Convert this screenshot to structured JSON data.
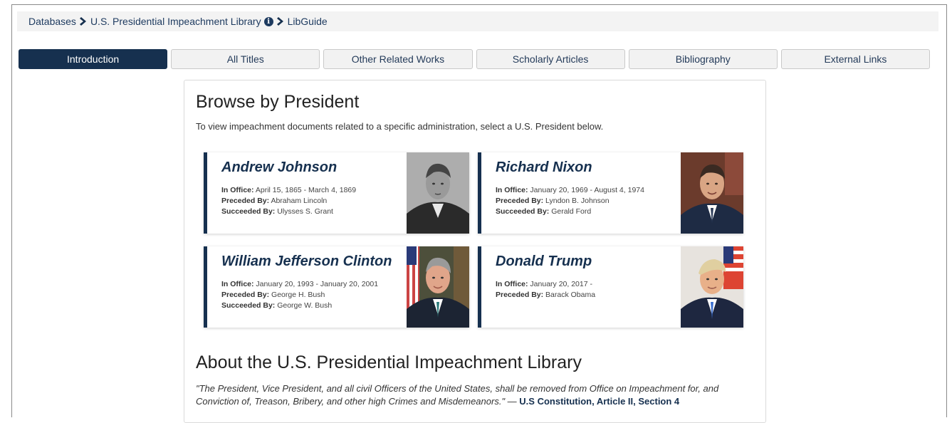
{
  "breadcrumb": {
    "items": [
      "Databases",
      "U.S. Presidential Impeachment Library",
      "LibGuide"
    ]
  },
  "tabs": [
    {
      "label": "Introduction",
      "active": true
    },
    {
      "label": "All Titles",
      "active": false
    },
    {
      "label": "Other Related Works",
      "active": false
    },
    {
      "label": "Scholarly Articles",
      "active": false
    },
    {
      "label": "Bibliography",
      "active": false
    },
    {
      "label": "External Links",
      "active": false
    }
  ],
  "browse": {
    "title": "Browse by President",
    "subtitle": "To view impeachment documents related to a specific administration, select a U.S. President below."
  },
  "presidents": [
    {
      "name": "Andrew Johnson",
      "in_office_label": "In Office:",
      "in_office": " April 15, 1865 - March 4, 1869",
      "preceded_label": "Preceded By:",
      "preceded": " Abraham Lincoln",
      "succeeded_label": "Succeeded By:",
      "succeeded": " Ulysses S. Grant"
    },
    {
      "name": "Richard Nixon",
      "in_office_label": "In Office:",
      "in_office": " January 20, 1969 - August 4, 1974",
      "preceded_label": "Preceded By:",
      "preceded": " Lyndon B. Johnson",
      "succeeded_label": "Succeeded By:",
      "succeeded": " Gerald Ford"
    },
    {
      "name": "William Jefferson Clinton",
      "in_office_label": "In Office:",
      "in_office": " January 20, 1993 - January 20, 2001",
      "preceded_label": "Preceded By:",
      "preceded": " George H. Bush",
      "succeeded_label": "Succeeded By:",
      "succeeded": " George W. Bush"
    },
    {
      "name": "Donald Trump",
      "in_office_label": "In Office:",
      "in_office": " January 20, 2017 -",
      "preceded_label": "Preceded By:",
      "preceded": " Barack Obama"
    }
  ],
  "about": {
    "title": "About the U.S. Presidential Impeachment Library",
    "quote": "\"The President, Vice President, and all civil Officers of the United States, shall be removed from Office on Impeachment for, and Conviction of, Treason, Bribery, and other high Crimes and Misdemeanors.\" — ",
    "citation": "U.S Constitution, Article II, Section 4"
  },
  "colors": {
    "primary": "#16304f",
    "tab_bg": "#f2f2f2",
    "breadcrumb_bg": "#f3f3f3"
  }
}
